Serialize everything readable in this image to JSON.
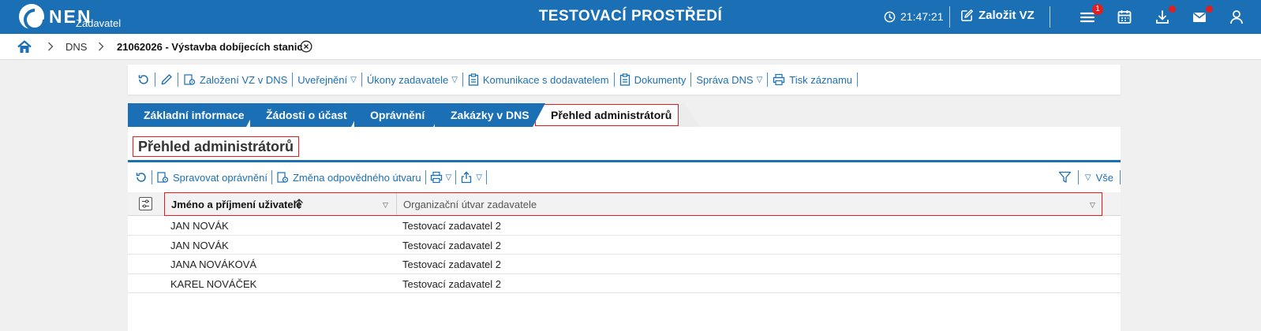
{
  "header": {
    "logo_text": "NEN",
    "logo_sub": "Zadavatel",
    "env_title": "TESTOVACÍ PROSTŘEDÍ",
    "clock": "21:47:21",
    "create_label": "Založit VZ",
    "menu_badge": "1"
  },
  "breadcrumb": {
    "dns": "DNS",
    "current": "21062026 - Výstavba dobíjecích stanic"
  },
  "actions": {
    "zalozeni": "Založení VZ v DNS",
    "uverejneni": "Uveřejnění",
    "ukony": "Úkony zadavatele",
    "komunikace": "Komunikace s dodavatelem",
    "dokumenty": "Dokumenty",
    "sprava": "Správa DNS",
    "tisk": "Tisk záznamu"
  },
  "tabs": [
    {
      "label": "Základní informace"
    },
    {
      "label": "Žádosti o účast"
    },
    {
      "label": "Oprávnění"
    },
    {
      "label": "Zakázky v DNS"
    },
    {
      "label": "Přehled administrátorů"
    }
  ],
  "section": {
    "title": "Přehled administrátorů",
    "spravovat": "Spravovat oprávnění",
    "zmena": "Změna odpovědného útvaru",
    "vse": "Vše"
  },
  "grid": {
    "columns": [
      "Jméno a příjmení uživatele",
      "Organizační útvar zadavatele"
    ],
    "rows": [
      [
        "JAN NOVÁK",
        "Testovací zadavatel 2"
      ],
      [
        "JAN NOVÁK",
        "Testovací zadavatel 2"
      ],
      [
        "JANA NOVÁKOVÁ",
        "Testovací zadavatel 2"
      ],
      [
        "KAREL NOVÁČEK",
        "Testovací zadavatel 2"
      ]
    ]
  },
  "colors": {
    "brand": "#1b6fb5",
    "highlight": "#e02020"
  }
}
